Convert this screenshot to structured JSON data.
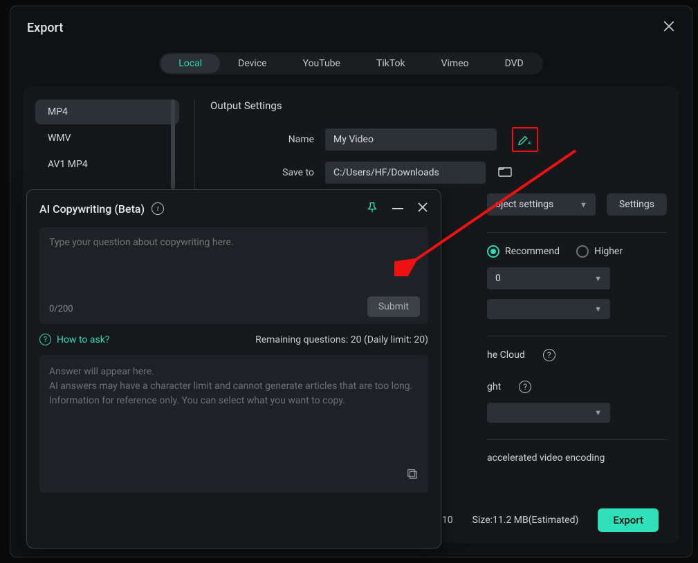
{
  "header": {
    "title": "Export"
  },
  "tabs": [
    "Local",
    "Device",
    "YouTube",
    "TikTok",
    "Vimeo",
    "DVD"
  ],
  "active_tab_index": 0,
  "formats": [
    "MP4",
    "WMV",
    "AV1 MP4"
  ],
  "active_format_index": 0,
  "output": {
    "section_title": "Output Settings",
    "name_label": "Name",
    "name_value": "My Video",
    "saveto_label": "Save to",
    "saveto_value": "C:/Users/HF/Downloads",
    "preset_visible_partial": "oject settings",
    "settings_btn": "Settings",
    "quality_recommend": "Recommend",
    "quality_higher": "Higher",
    "dropdown_partial_value": "0",
    "cloud_partial": "he Cloud",
    "ght_partial": "ght",
    "encoding_partial": "accelerated video encoding"
  },
  "footer": {
    "num_partial": "10",
    "size_label": "Size:",
    "size_value": "11.2 MB(Estimated)",
    "export_btn": "Export"
  },
  "ai": {
    "title": "AI Copywriting (Beta)",
    "placeholder": "Type your question about copywriting here.",
    "counter": "0/200",
    "submit": "Submit",
    "howto": "How to ask?",
    "remaining": "Remaining questions: 20 (Daily limit: 20)",
    "answer_placeholder_l1": "Answer will appear here.",
    "answer_placeholder_l2": "AI answers may have a character limit and cannot generate articles that are too long.",
    "answer_placeholder_l3": "Information for reference only. You can select what you want to copy."
  }
}
